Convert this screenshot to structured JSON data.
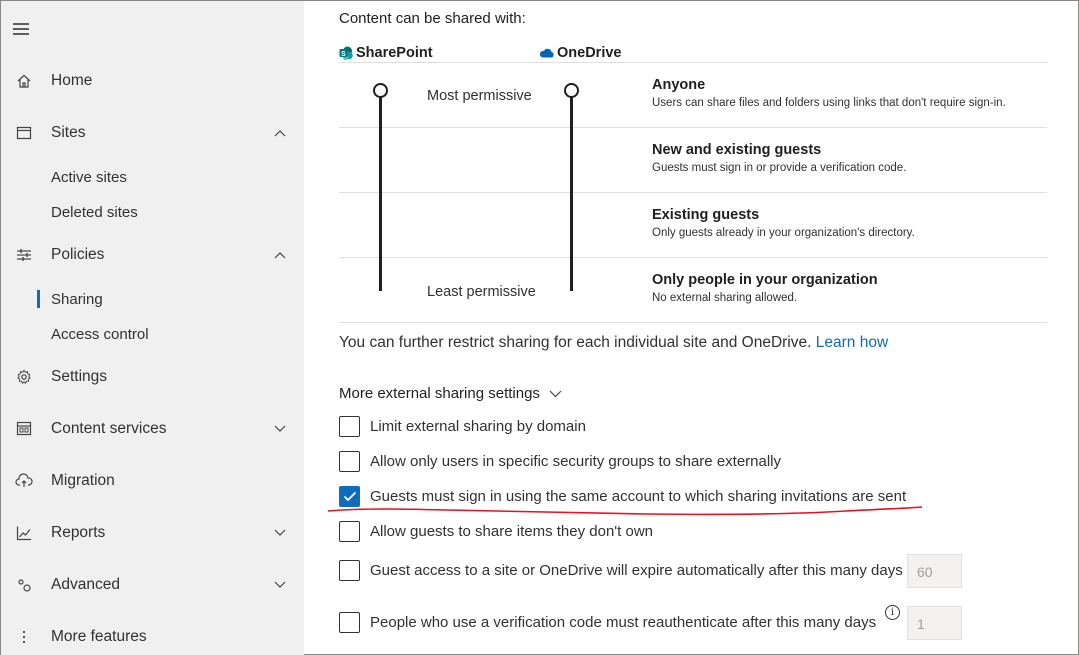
{
  "sidebar": {
    "menu_icon": "hamburger-icon",
    "home": {
      "label": "Home",
      "icon": "home-icon"
    },
    "sites": {
      "label": "Sites",
      "icon": "sites-icon",
      "chevron": "up"
    },
    "active_sites": {
      "label": "Active sites"
    },
    "deleted_sites": {
      "label": "Deleted sites"
    },
    "policies": {
      "label": "Policies",
      "icon": "sliders-icon",
      "chevron": "up"
    },
    "sharing": {
      "label": "Sharing",
      "active": true
    },
    "access_control": {
      "label": "Access control"
    },
    "settings": {
      "label": "Settings",
      "icon": "gear-icon"
    },
    "content_services": {
      "label": "Content services",
      "icon": "content-services-icon",
      "chevron": "down"
    },
    "migration": {
      "label": "Migration",
      "icon": "cloud-upload-icon"
    },
    "reports": {
      "label": "Reports",
      "icon": "line-chart-icon",
      "chevron": "down"
    },
    "advanced": {
      "label": "Advanced",
      "icon": "advanced-icon",
      "chevron": "down"
    },
    "more_features": {
      "label": "More features",
      "icon": "more-vertical-icon"
    }
  },
  "main": {
    "section_title": "Content can be shared with:",
    "sharepoint_label": "SharePoint",
    "onedrive_label": "OneDrive",
    "most_permissive": "Most permissive",
    "least_permissive": "Least permissive",
    "levels": [
      {
        "title": "Anyone",
        "desc": "Users can share files and folders using links that don't require sign-in."
      },
      {
        "title": "New and existing guests",
        "desc": "Guests must sign in or provide a verification code."
      },
      {
        "title": "Existing guests",
        "desc": "Only guests already in your organization's directory."
      },
      {
        "title": "Only people in your organization",
        "desc": "No external sharing allowed."
      }
    ],
    "sharepoint_level": "Anyone",
    "onedrive_level": "Anyone",
    "restrict_text": "You can further restrict sharing for each individual site and OneDrive.",
    "learn_how": "Learn how",
    "more_settings_label": "More external sharing settings",
    "options": [
      {
        "label": "Limit external sharing by domain",
        "checked": false
      },
      {
        "label": "Allow only users in specific security groups to share externally",
        "checked": false
      },
      {
        "label": "Guests must sign in using the same account to which sharing invitations are sent",
        "checked": true
      },
      {
        "label": "Allow guests to share items they don't own",
        "checked": false
      },
      {
        "label": "Guest access to a site or OneDrive will expire automatically after this many days",
        "checked": false,
        "value": "60"
      },
      {
        "label": "People who use a verification code must reauthenticate after this many days",
        "checked": false,
        "value": "1"
      }
    ],
    "annotation_color": "#e81123",
    "accent_color": "#0f6cbd"
  }
}
